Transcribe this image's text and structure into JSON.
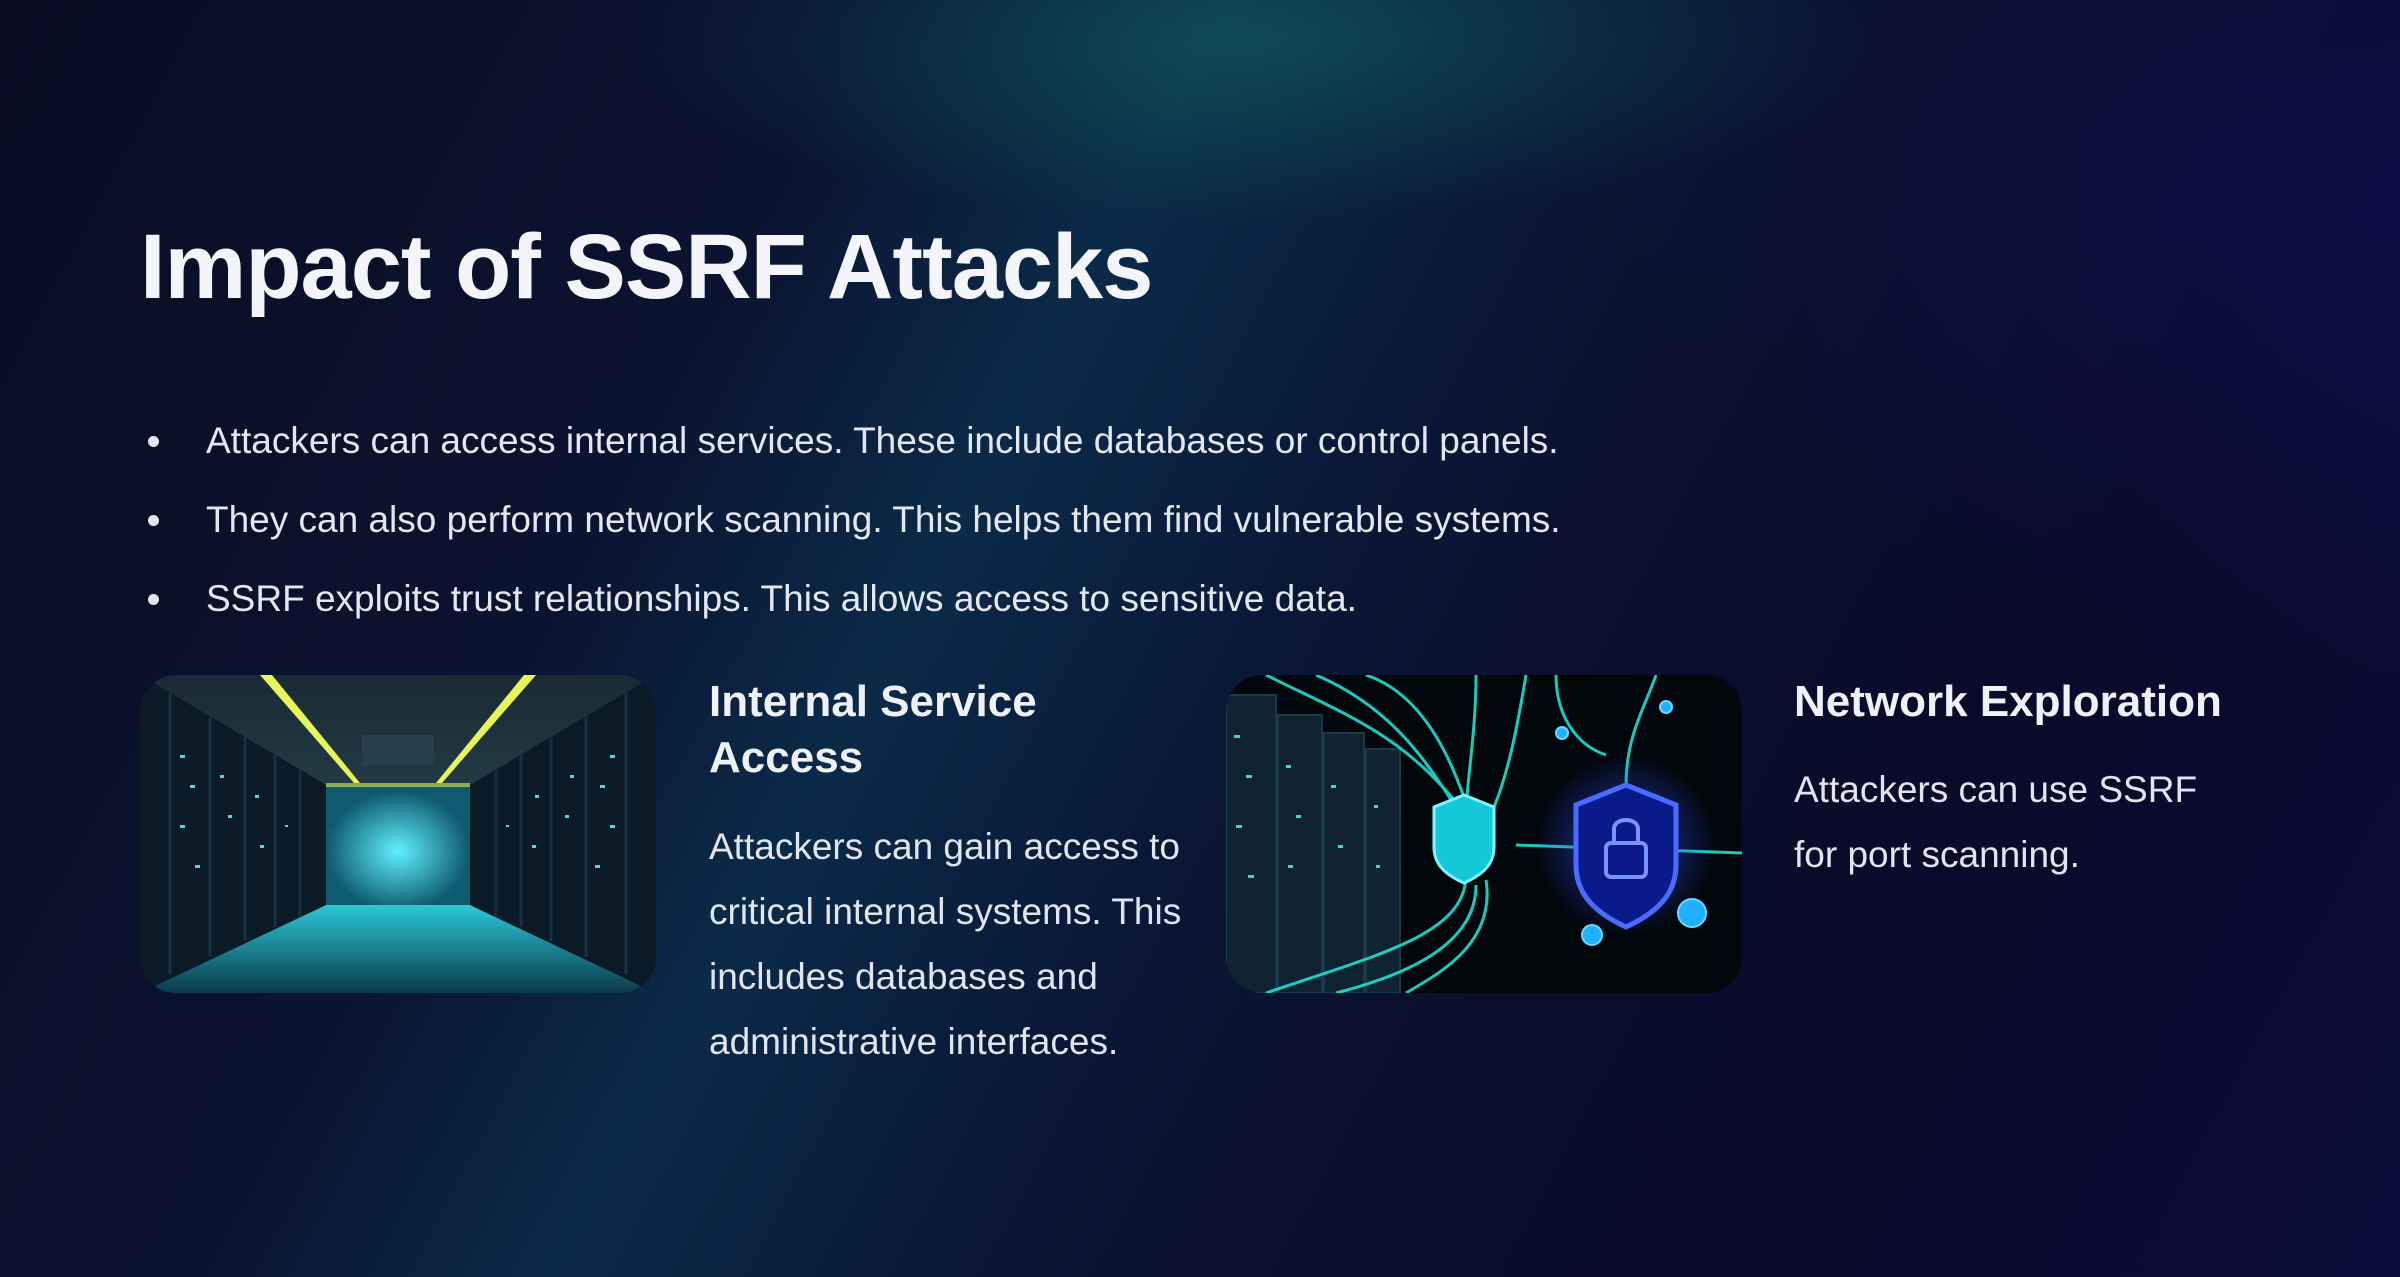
{
  "slide": {
    "title": "Impact of SSRF Attacks",
    "bullets": [
      "Attackers can access internal services. These include databases or control panels.",
      "They can also perform network scanning. This helps them find vulnerable systems.",
      "SSRF exploits trust relationships. This allows access to sensitive data."
    ],
    "cards": [
      {
        "image": "server-room-corridor-image",
        "title": "Internal Service Access",
        "description": "Attackers can gain access to critical internal systems. This includes databases and administrative interfaces."
      },
      {
        "image": "network-security-shield-image",
        "title": "Network Exploration",
        "description": "Attackers can use SSRF for port scanning."
      }
    ]
  },
  "colors": {
    "background": "#0a0d22",
    "accent_teal": "#1fd6c8",
    "accent_blue": "#2d4bff",
    "text": "#e6e9f2"
  }
}
